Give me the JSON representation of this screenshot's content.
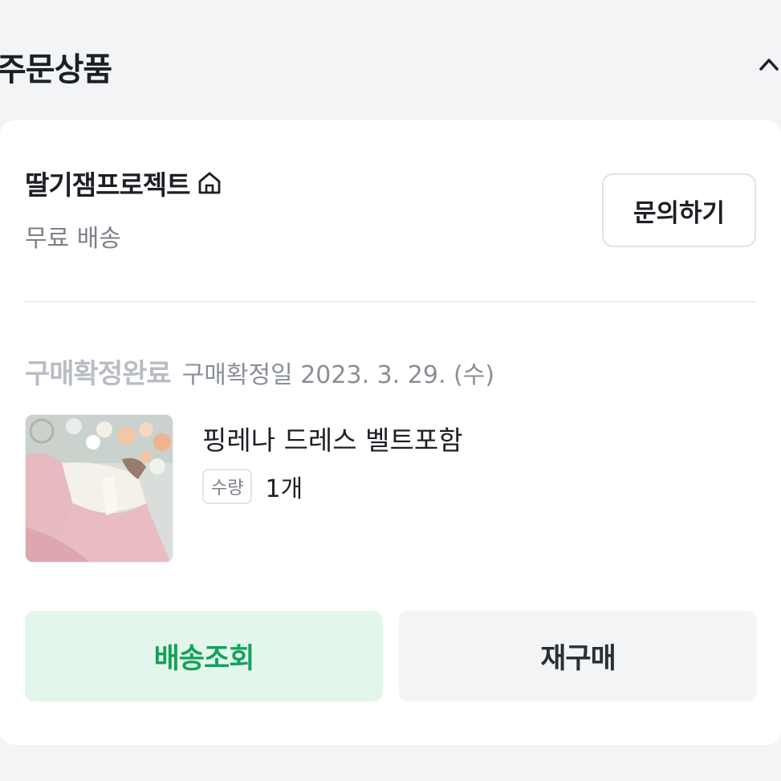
{
  "section": {
    "title": "주문상품",
    "collapse_icon": "chevron-up-icon"
  },
  "order": {
    "seller": {
      "name": "딸기잼프로젝트",
      "store_icon": "home-icon",
      "shipping": "무료 배송"
    },
    "inquiry_button": "문의하기",
    "status": {
      "label": "구매확정완료",
      "date_text": "구매확정일 2023. 3. 29. (수)"
    },
    "product": {
      "name": "핑레나 드레스 벨트포함",
      "quantity_label": "수량",
      "quantity_value": "1개"
    },
    "actions": {
      "track_label": "배송조회",
      "rebuy_label": "재구매"
    }
  },
  "colors": {
    "page_background": "#f2f4f6",
    "card_background": "#ffffff",
    "track_button_bg": "#e3f6ec",
    "track_button_text": "#14a25a",
    "rebuy_button_bg": "#f2f4f6",
    "status_text": "#b9bdc3"
  }
}
